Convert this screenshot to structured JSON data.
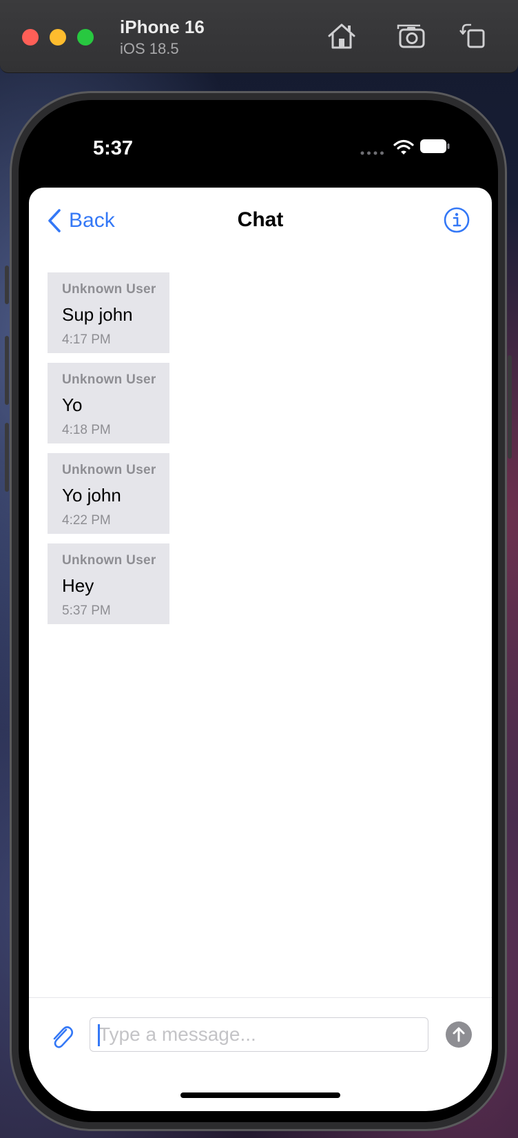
{
  "simulator": {
    "device_name": "iPhone 16",
    "os_version": "iOS 18.5",
    "icons": [
      "home-icon",
      "screenshot-camera-icon",
      "rotate-icon"
    ]
  },
  "status_bar": {
    "time": "5:37",
    "icons": [
      "cellular-dots-icon",
      "wifi-icon",
      "battery-icon"
    ]
  },
  "nav": {
    "back_label": "Back",
    "title": "Chat",
    "info_icon": "info-icon"
  },
  "messages": [
    {
      "sender": "Unknown User",
      "text": "Sup john",
      "time": "4:17 PM"
    },
    {
      "sender": "Unknown User",
      "text": "Yo",
      "time": "4:18 PM"
    },
    {
      "sender": "Unknown User",
      "text": "Yo john",
      "time": "4:22 PM"
    },
    {
      "sender": "Unknown User",
      "text": "Hey",
      "time": "5:37 PM"
    }
  ],
  "composer": {
    "placeholder": "Type a message...",
    "value": "",
    "attach_icon": "paperclip-icon",
    "send_icon": "arrow-up-icon"
  },
  "colors": {
    "accent": "#3478f6",
    "bubble": "#e5e5ea",
    "secondary_text": "#8e8e93"
  }
}
